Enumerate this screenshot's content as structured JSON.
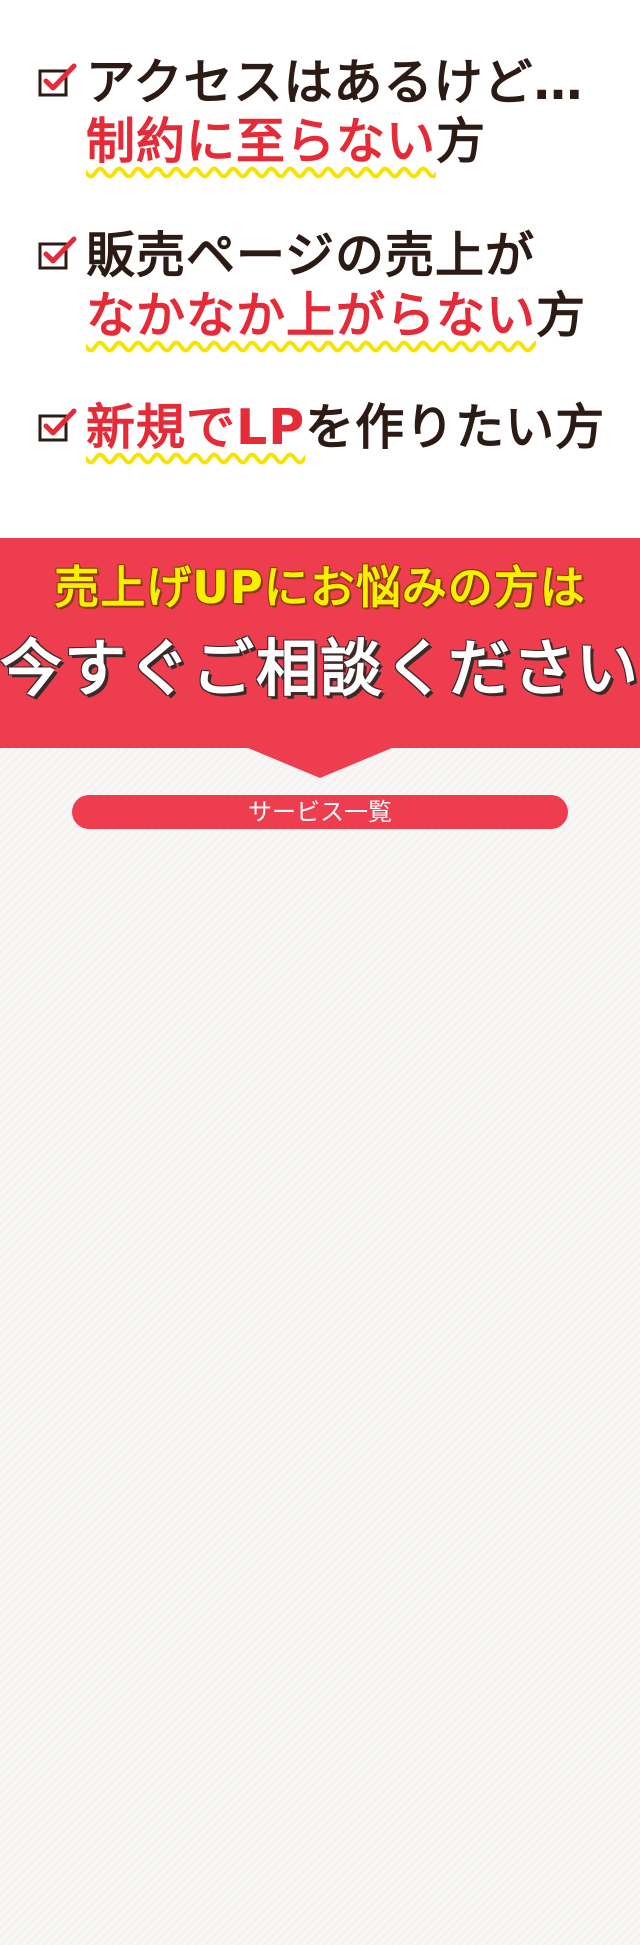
{
  "checklist": [
    {
      "line1": "アクセスはあるけど…",
      "line2_red": "制約に至らない",
      "line2_tail": "方"
    },
    {
      "line1": "販売ページの売上が",
      "line2_red": "なかなか上がらない",
      "line2_tail": "方"
    },
    {
      "line1_red": "新規でLP",
      "line1_tail": "を作りたい方"
    }
  ],
  "banner": {
    "headline": "売上げUPにお悩みの方は",
    "subheadline": "今すぐご相談ください"
  },
  "services_button": {
    "label": "サービス一覧"
  },
  "colors": {
    "accent_red": "#ee3d4f",
    "text_red": "#e52a38",
    "yellow": "#f7f000",
    "dark_text": "#2c1a14"
  },
  "icons": {
    "check": "checkbox-check-icon"
  }
}
